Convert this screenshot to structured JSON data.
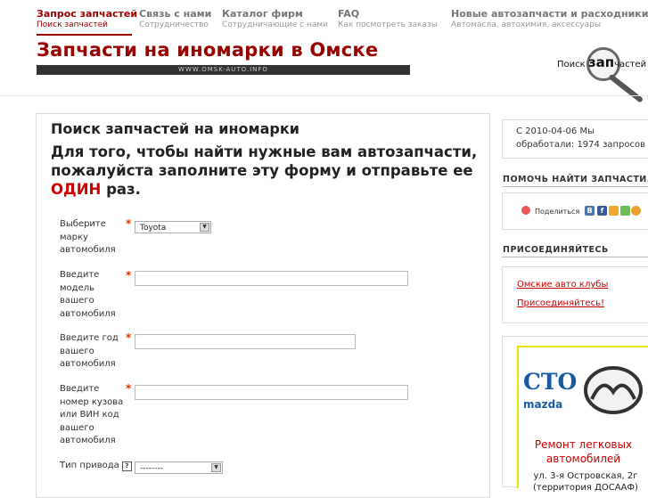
{
  "nav": {
    "items": [
      {
        "title": "Запрос запчастей",
        "subtitle": "Поиск запчастей",
        "active": true
      },
      {
        "title": "Связь с нами",
        "subtitle": "Сотрудничество",
        "active": false
      },
      {
        "title": "Каталог фирм",
        "subtitle": "Сотрудничающие с нами",
        "active": false
      },
      {
        "title": "FAQ",
        "subtitle": "Как посмотреть заказы",
        "active": false
      },
      {
        "title": "Новые автозапчасти и расходники",
        "subtitle": "Автомасла, автохимия, аксессуары",
        "active": false
      }
    ]
  },
  "header": {
    "site_title": "Запчасти на иномарки в Омске",
    "url": "WWW.OMSK-AUTO.INFO",
    "search_logo": {
      "prefix": "Поиск ",
      "big": "зап",
      "suffix": "частей"
    }
  },
  "form": {
    "title": "Поиск запчастей на иномарки",
    "intro_before": "Для того, чтобы найти нужные вам автозапчасти, пожалуйста заполните эту форму и отправьте ее ",
    "intro_emphasis": "ОДИН",
    "intro_after": " раз.",
    "required_mark": "*",
    "fields": {
      "make": {
        "label": "Выберите марку автомобиля",
        "value": "Toyota"
      },
      "model": {
        "label": "Введите модель вашего автомобиля",
        "value": ""
      },
      "year": {
        "label": "Введите год вашего автомобиля",
        "value": ""
      },
      "vin": {
        "label": "Введите номер кузова или ВИН код вашего автомобиля",
        "value": ""
      },
      "drive": {
        "label": "Тип привода",
        "help": "?",
        "value": "--------"
      }
    }
  },
  "sidebar": {
    "counter_text": "С 2010-04-06 Мы обработали: 1974 запросов",
    "help_heading": "ПОМОЧЬ НАЙТИ ЗАПЧАСТИ.",
    "share_label": "Поделиться",
    "join_heading": "ПРИСОЕДИНЯЙТЕСЬ",
    "links": [
      "Омские авто клубы",
      "Присоединяйтесь!"
    ],
    "ad": {
      "brand_big": "СТО",
      "brand_small": "mazda",
      "service": "Ремонт легковых автомобилей",
      "address": "ул. 3-я Островская, 2г (территория ДОСААФ)"
    }
  },
  "colors": {
    "accent": "#990000",
    "highlight": "#cc0000",
    "ad_blue": "#1a5aa0"
  }
}
